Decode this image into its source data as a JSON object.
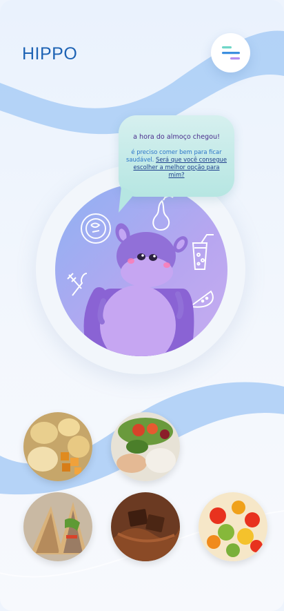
{
  "app": {
    "title": "HIPPO"
  },
  "menu": {
    "icon": "menu-lines-icon"
  },
  "speech_bubble": {
    "title": "a hora do almoço chegou!",
    "body_plain": "é preciso comer bem para ficar saudável.",
    "body_link": "Será que você consegue escolher a melhor opção para mim?"
  },
  "mascot": {
    "icon": "hippo-icon"
  },
  "doodles": [
    "plate-icon",
    "pear-icon",
    "drink-icon",
    "cutlery-icon",
    "watermelon-icon"
  ],
  "foods": [
    {
      "name": "snacks-chips"
    },
    {
      "name": "salad-chicken"
    },
    {
      "name": "sandwich"
    },
    {
      "name": "chocolate"
    },
    {
      "name": "fruit-salad"
    }
  ],
  "colors": {
    "brand": "#1e63b4",
    "bubble": "#b6e6e2",
    "hippo": "#9170d8",
    "circle": "#a9acf2"
  }
}
